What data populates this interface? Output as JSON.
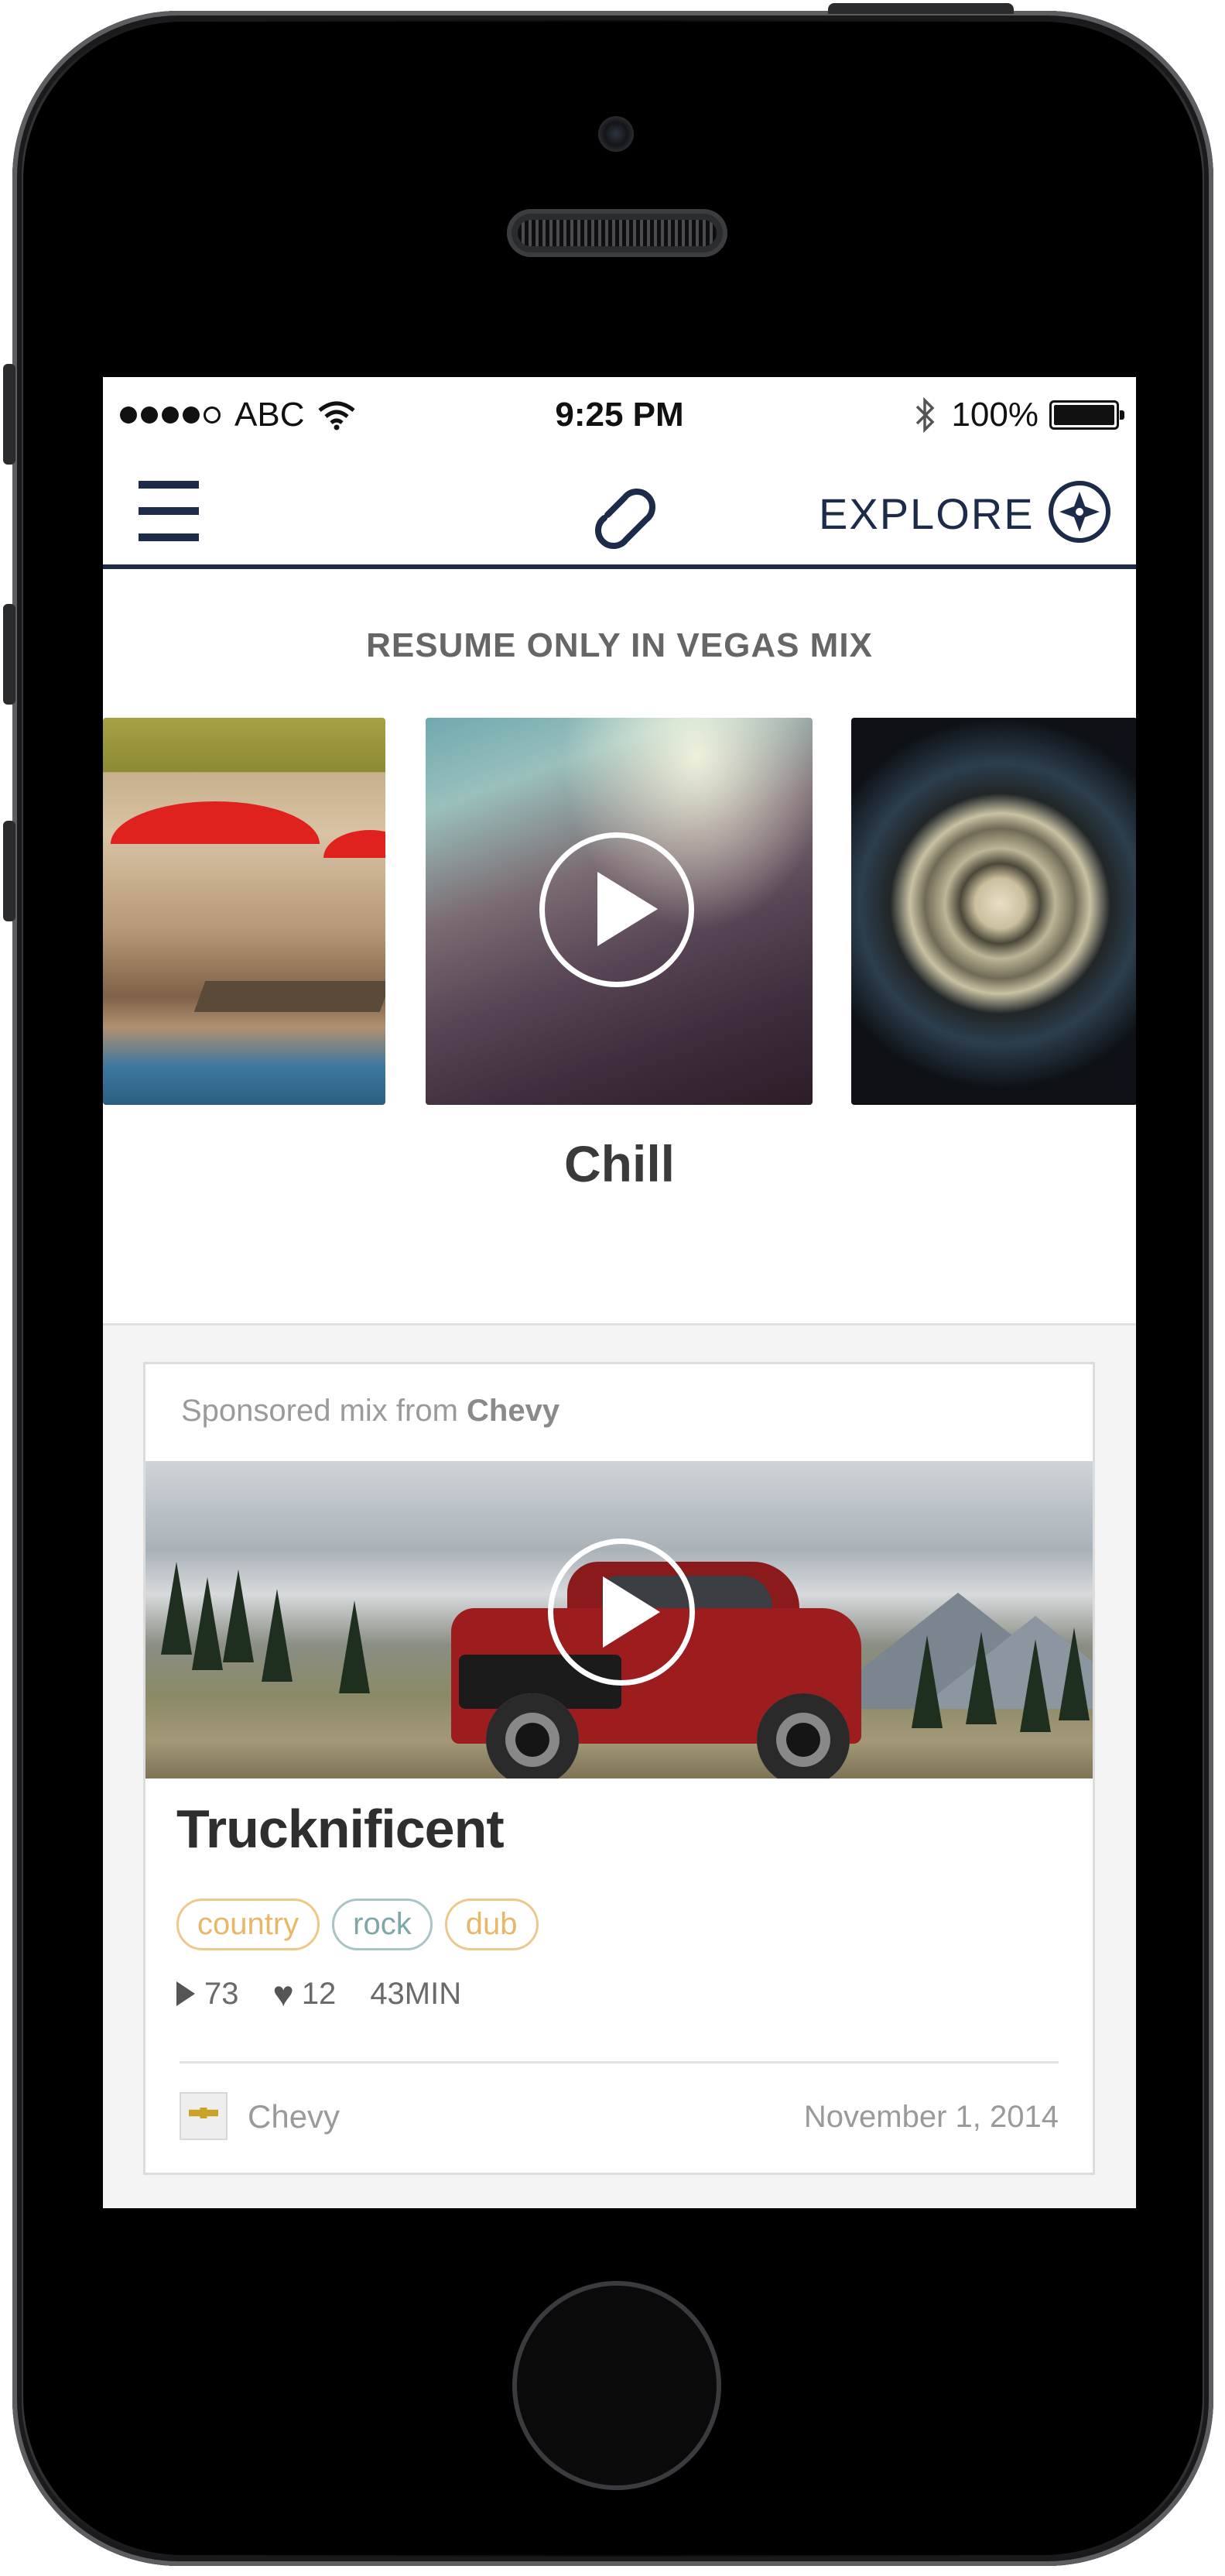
{
  "status_bar": {
    "carrier": "ABC",
    "time": "9:25 PM",
    "battery": "100%",
    "signal_bars": 4,
    "icons": [
      "wifi-icon",
      "bluetooth-icon",
      "battery-icon"
    ]
  },
  "nav": {
    "menu_icon": "hamburger-menu-icon",
    "logo_icon": "8tracks-logo-icon",
    "explore_label": "EXPLORE",
    "explore_icon": "compass-icon"
  },
  "resume": {
    "title": "RESUME ONLY IN VEGAS MIX",
    "current_mix": "Chill"
  },
  "sponsored": {
    "prefix": "Sponsored mix from",
    "brand": "Chevy",
    "title": "Trucknificent",
    "tags": [
      "country",
      "rock",
      "dub"
    ],
    "plays": "73",
    "likes": "12",
    "duration": "43MIN",
    "author": "Chevy",
    "date": "November 1, 2014"
  },
  "colors": {
    "navy": "#1d2b4b",
    "tag_gold": "#e6b868",
    "tag_teal": "#7fa6a8"
  }
}
